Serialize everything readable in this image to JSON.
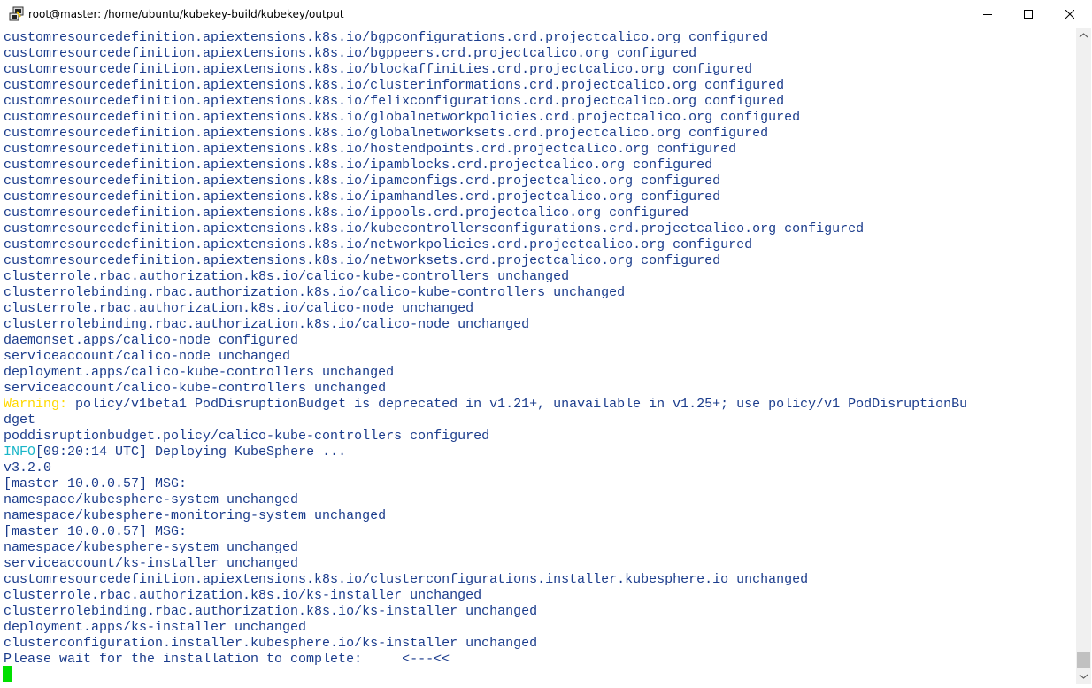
{
  "window": {
    "title": "root@master: /home/ubuntu/kubekey-build/kubekey/output",
    "icon": "putty-icon",
    "controls": [
      "minimize-icon",
      "maximize-icon",
      "close-icon"
    ]
  },
  "terminal": {
    "colors": {
      "default": "#1b3c8c",
      "warning": "#ffd800",
      "info": "#19b5c8",
      "cursor": "#00e000"
    },
    "lines": [
      "customresourcedefinition.apiextensions.k8s.io/bgpconfigurations.crd.projectcalico.org configured",
      "customresourcedefinition.apiextensions.k8s.io/bgppeers.crd.projectcalico.org configured",
      "customresourcedefinition.apiextensions.k8s.io/blockaffinities.crd.projectcalico.org configured",
      "customresourcedefinition.apiextensions.k8s.io/clusterinformations.crd.projectcalico.org configured",
      "customresourcedefinition.apiextensions.k8s.io/felixconfigurations.crd.projectcalico.org configured",
      "customresourcedefinition.apiextensions.k8s.io/globalnetworkpolicies.crd.projectcalico.org configured",
      "customresourcedefinition.apiextensions.k8s.io/globalnetworksets.crd.projectcalico.org configured",
      "customresourcedefinition.apiextensions.k8s.io/hostendpoints.crd.projectcalico.org configured",
      "customresourcedefinition.apiextensions.k8s.io/ipamblocks.crd.projectcalico.org configured",
      "customresourcedefinition.apiextensions.k8s.io/ipamconfigs.crd.projectcalico.org configured",
      "customresourcedefinition.apiextensions.k8s.io/ipamhandles.crd.projectcalico.org configured",
      "customresourcedefinition.apiextensions.k8s.io/ippools.crd.projectcalico.org configured",
      "customresourcedefinition.apiextensions.k8s.io/kubecontrollersconfigurations.crd.projectcalico.org configured",
      "customresourcedefinition.apiextensions.k8s.io/networkpolicies.crd.projectcalico.org configured",
      "customresourcedefinition.apiextensions.k8s.io/networksets.crd.projectcalico.org configured",
      "clusterrole.rbac.authorization.k8s.io/calico-kube-controllers unchanged",
      "clusterrolebinding.rbac.authorization.k8s.io/calico-kube-controllers unchanged",
      "clusterrole.rbac.authorization.k8s.io/calico-node unchanged",
      "clusterrolebinding.rbac.authorization.k8s.io/calico-node unchanged",
      "daemonset.apps/calico-node configured",
      "serviceaccount/calico-node unchanged",
      "deployment.apps/calico-kube-controllers unchanged",
      "serviceaccount/calico-kube-controllers unchanged"
    ],
    "warning_label": "Warning:",
    "warning_text": " policy/v1beta1 PodDisruptionBudget is deprecated in v1.21+, unavailable in v1.25+; use policy/v1 PodDisruptionBu",
    "warning_wrap": "dget",
    "pdb_line": "poddisruptionbudget.policy/calico-kube-controllers configured",
    "info_label": "INFO",
    "info_text": "[09:20:14 UTC] Deploying KubeSphere ...",
    "lines2": [
      "v3.2.0",
      "[master 10.0.0.57] MSG:",
      "namespace/kubesphere-system unchanged",
      "namespace/kubesphere-monitoring-system unchanged",
      "[master 10.0.0.57] MSG:",
      "namespace/kubesphere-system unchanged",
      "serviceaccount/ks-installer unchanged",
      "customresourcedefinition.apiextensions.k8s.io/clusterconfigurations.installer.kubesphere.io unchanged",
      "clusterrole.rbac.authorization.k8s.io/ks-installer unchanged",
      "clusterrolebinding.rbac.authorization.k8s.io/ks-installer unchanged",
      "deployment.apps/ks-installer unchanged",
      "clusterconfiguration.installer.kubesphere.io/ks-installer unchanged",
      "Please wait for the installation to complete:     <---<<"
    ]
  }
}
